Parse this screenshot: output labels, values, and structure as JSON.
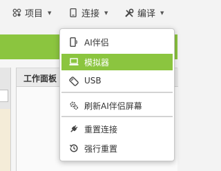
{
  "menubar": {
    "project_label": "项目",
    "connect_label": "连接",
    "build_label": "编译"
  },
  "workspace": {
    "panel_title": "工作面板"
  },
  "connect_menu": {
    "items": [
      {
        "label": "AI伴侣",
        "icon": "phone-icon"
      },
      {
        "label": "模拟器",
        "icon": "laptop-icon",
        "active": true
      },
      {
        "label": "USB",
        "icon": "usb-icon"
      },
      {
        "label": "刷新AI伴侣屏幕",
        "icon": "gear-refresh-icon"
      },
      {
        "label": "重置连接",
        "icon": "plug-icon"
      },
      {
        "label": "强行重置",
        "icon": "history-icon"
      }
    ]
  },
  "colors": {
    "accent_green": "#8bc53f",
    "menu_bg": "#ffffff",
    "menubar_bg": "#f3f3f3"
  }
}
